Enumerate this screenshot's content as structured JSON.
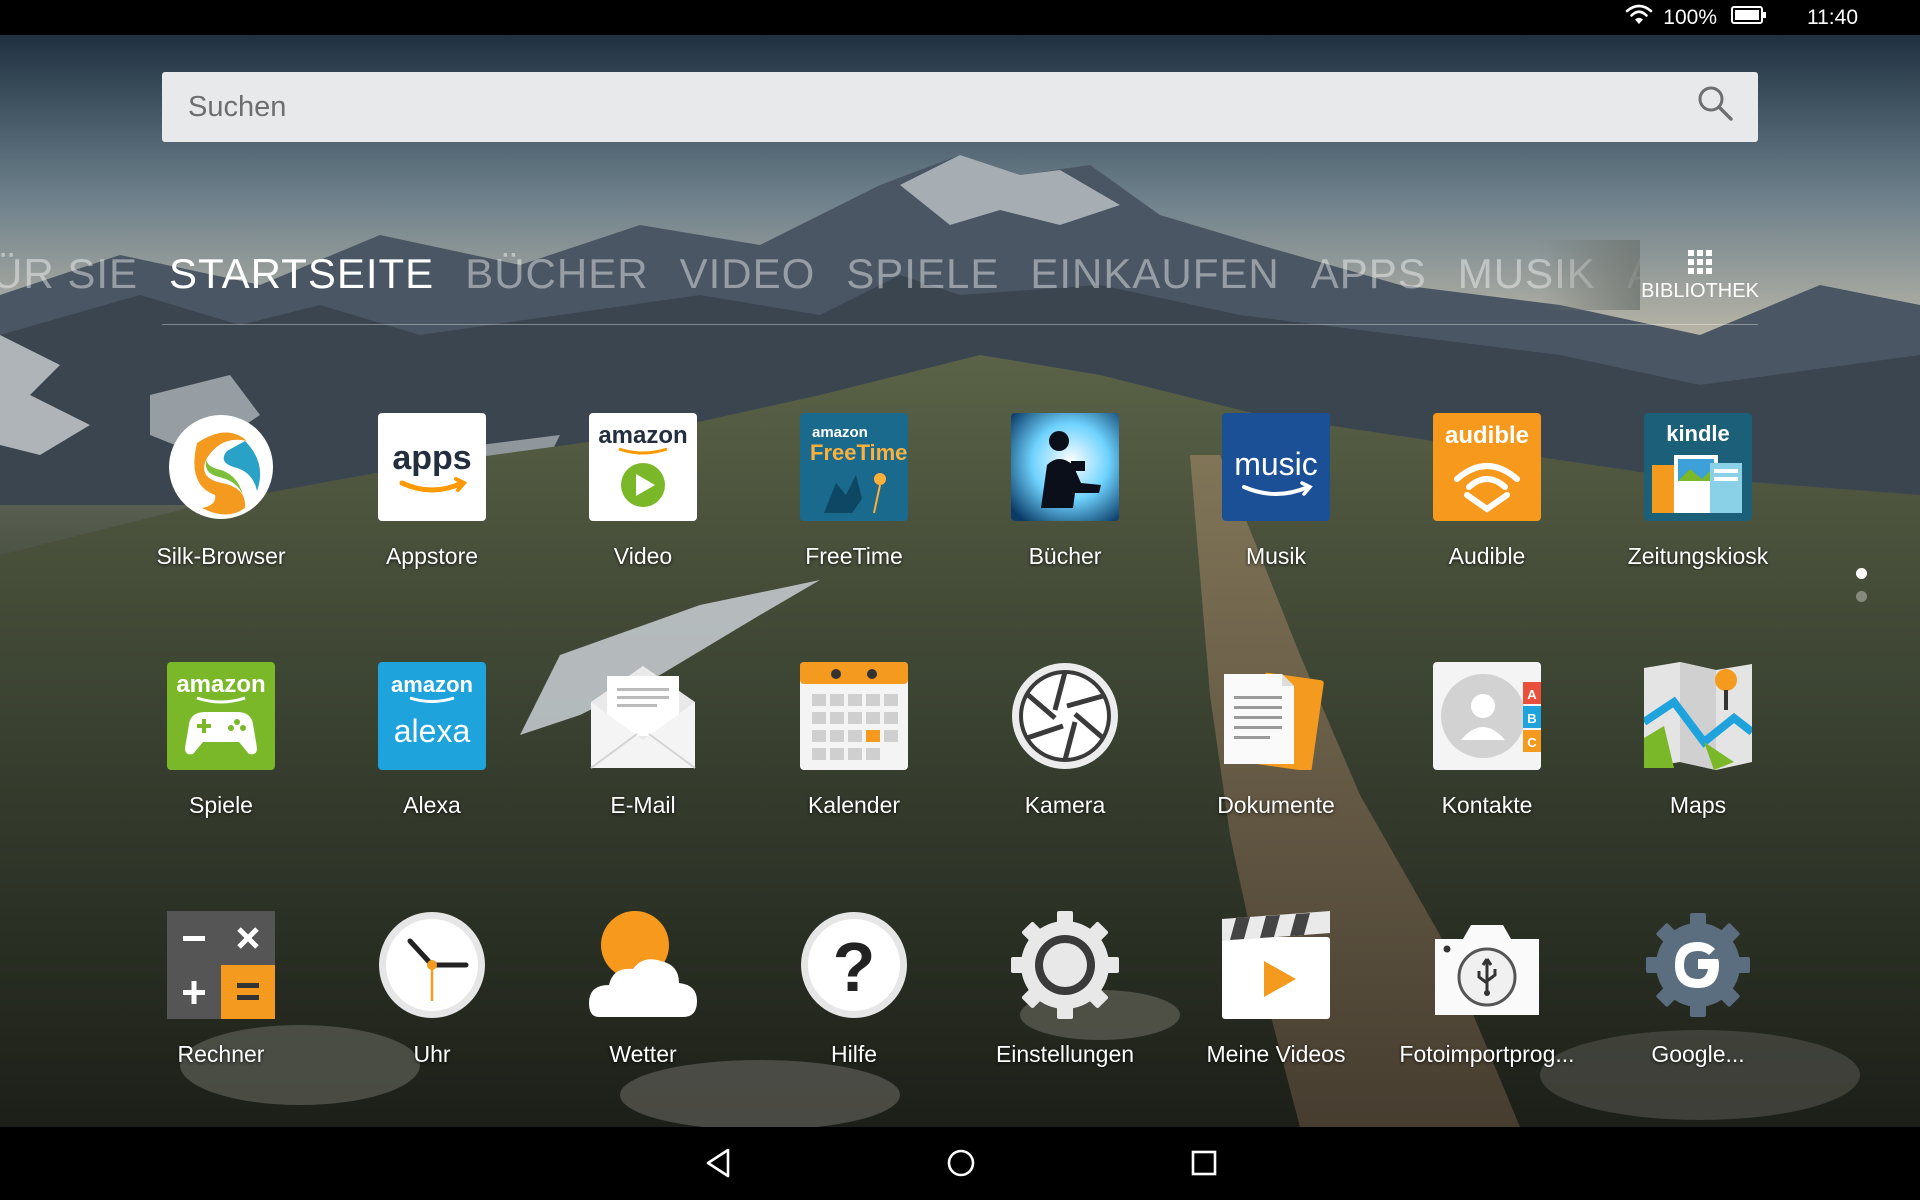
{
  "status_bar": {
    "wifi_icon": "wifi-icon",
    "battery_percent": "100%",
    "battery_icon": "battery-icon",
    "time": "11:40"
  },
  "search": {
    "placeholder": "Suchen",
    "icon": "search-icon"
  },
  "tabs": [
    {
      "label": "ÜR SIE",
      "active": false
    },
    {
      "label": "STARTSEITE",
      "active": true
    },
    {
      "label": "BÜCHER",
      "active": false
    },
    {
      "label": "VIDEO",
      "active": false
    },
    {
      "label": "SPIELE",
      "active": false
    },
    {
      "label": "EINKAUFEN",
      "active": false
    },
    {
      "label": "APPS",
      "active": false
    },
    {
      "label": "MUSIK",
      "active": false
    },
    {
      "label": "AUDIB",
      "active": false
    }
  ],
  "library": {
    "label": "BIBLIOTHEK",
    "icon": "grid-icon"
  },
  "apps": [
    {
      "label": "Silk-Browser"
    },
    {
      "label": "Appstore",
      "icon_text": "apps"
    },
    {
      "label": "Video",
      "icon_text": "amazon"
    },
    {
      "label": "FreeTime",
      "icon_text_top": "amazon",
      "icon_text": "FreeTime"
    },
    {
      "label": "Bücher"
    },
    {
      "label": "Musik",
      "icon_text": "music"
    },
    {
      "label": "Audible",
      "icon_text": "audible"
    },
    {
      "label": "Zeitungskiosk",
      "icon_text": "kindle"
    },
    {
      "label": "Spiele",
      "icon_text": "amazon"
    },
    {
      "label": "Alexa",
      "icon_text_top": "amazon",
      "icon_text": "alexa"
    },
    {
      "label": "E-Mail"
    },
    {
      "label": "Kalender"
    },
    {
      "label": "Kamera"
    },
    {
      "label": "Dokumente"
    },
    {
      "label": "Kontakte",
      "icon_letters": [
        "A",
        "B",
        "C"
      ]
    },
    {
      "label": "Maps"
    },
    {
      "label": "Rechner"
    },
    {
      "label": "Uhr"
    },
    {
      "label": "Wetter"
    },
    {
      "label": "Hilfe",
      "icon_text": "?"
    },
    {
      "label": "Einstellungen"
    },
    {
      "label": "Meine Videos"
    },
    {
      "label": "Fotoimportprog..."
    },
    {
      "label": "Google..."
    }
  ],
  "colors": {
    "amazon_orange": "#ff9900",
    "alexa_blue": "#1ea3dc",
    "music_blue": "#1b4f96",
    "games_green": "#7ab829",
    "kindle_teal": "#1c5f78"
  },
  "page_indicator": {
    "current": 1,
    "total": 2
  },
  "nav_bar": {
    "back": "back-icon",
    "home": "home-icon",
    "recents": "recents-icon"
  }
}
